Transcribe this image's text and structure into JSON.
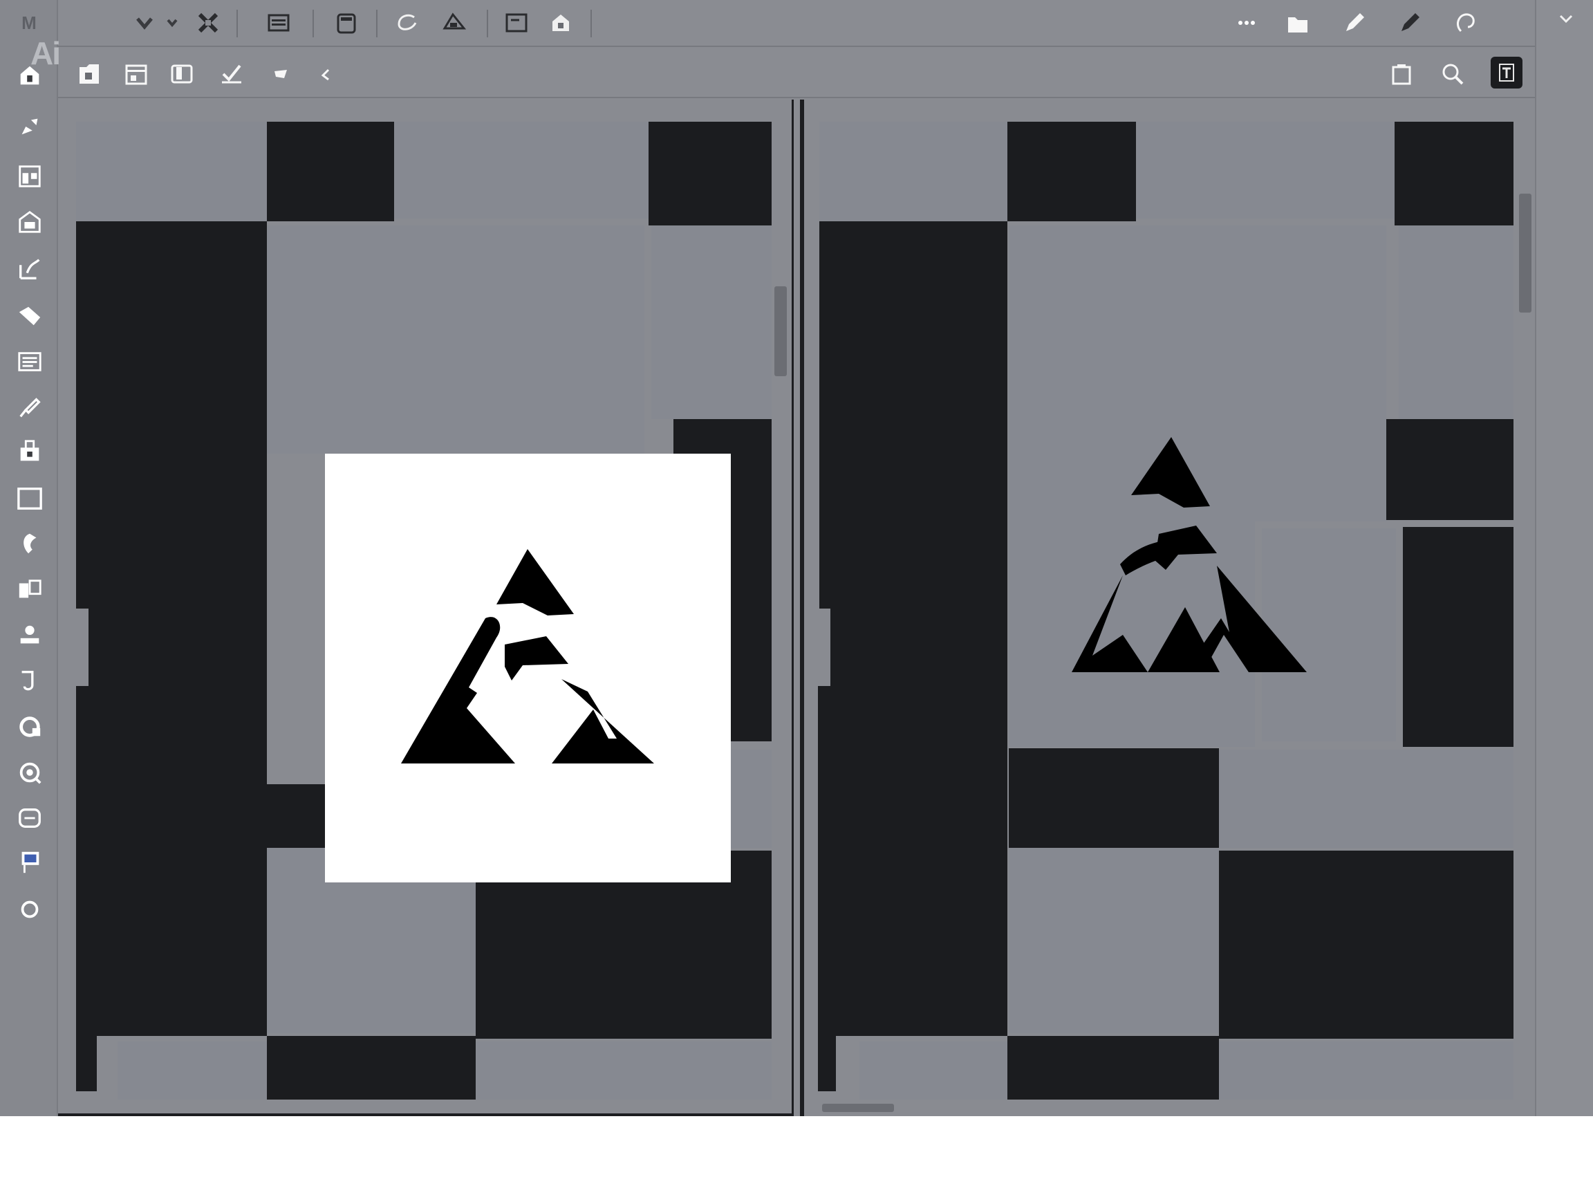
{
  "app": {
    "brand_mark": "M",
    "logo_text": "Ai"
  },
  "left_tools": [
    "home-icon",
    "pen-tool-icon",
    "layout-icon",
    "shape-builder-icon",
    "curvature-icon",
    "eraser-icon",
    "text-lines-icon",
    "brush-icon",
    "paint-bucket-icon",
    "rectangle-icon",
    "lasso-icon",
    "artboard-icon",
    "stamp-icon",
    "rotate-icon",
    "warp-icon",
    "eye-icon",
    "hand-icon",
    "screen-mode-icon",
    "circle-icon"
  ],
  "top_tools": [
    "chevron-down-icon",
    "chevron-small-icon",
    "transform-icon",
    "document-icon",
    "clipboard-icon",
    "lasso-select-icon",
    "fill-icon",
    "image-icon",
    "export-icon"
  ],
  "top_right_tools": [
    "more-icon",
    "folder-icon",
    "pencil-icon",
    "marker-icon",
    "loop-icon"
  ],
  "options_tools": [
    "save-icon",
    "frame-icon",
    "pages-icon",
    "edit-check-icon",
    "flag-icon",
    "undo-icon"
  ],
  "options_right_tools": [
    "trash-icon",
    "zoom-icon",
    "text-frame-icon"
  ],
  "colors": {
    "workspace": "#8a8c92",
    "dark_block": "#1b1c1f",
    "light_block": "#868991",
    "artboard": "#ffffff",
    "logo": "#000000"
  }
}
